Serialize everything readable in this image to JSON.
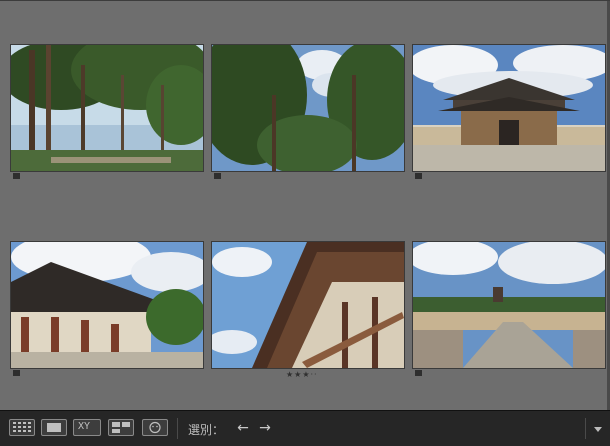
{
  "photos": [
    {
      "name": "pine-trees-path",
      "rating": null
    },
    {
      "name": "pine-canopy-sky",
      "rating": null
    },
    {
      "name": "temple-gate-hall",
      "rating": null
    },
    {
      "name": "temple-hall-roof",
      "rating": null
    },
    {
      "name": "roof-eaves-closeup",
      "rating": "★★★··"
    },
    {
      "name": "temple-stone-path",
      "rating": null
    }
  ],
  "toolbar": {
    "select_label": "選別：",
    "buttons": [
      "grid-view",
      "loupe-view",
      "compare-view",
      "survey-view",
      "people-view"
    ],
    "compare_text": "XY"
  }
}
